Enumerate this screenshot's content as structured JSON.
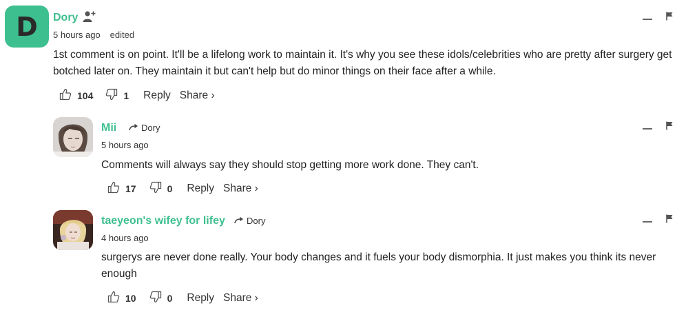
{
  "comments": [
    {
      "avatar_letter": "D",
      "author": "Dory",
      "time": "5 hours ago",
      "edited": "edited",
      "text": "1st comment is on point. It'll be a lifelong work to maintain it. It's why you see these idols/celebrities who are pretty after surgery get botched later on. They maintain it but can't help but do minor things on their face after a while.",
      "likes": "104",
      "dislikes": "1",
      "reply": "Reply",
      "share": "Share ›"
    },
    {
      "author": "Mii",
      "reply_to": "Dory",
      "time": "5 hours ago",
      "text": "Comments will always say they should stop getting more work done. They can't.",
      "likes": "17",
      "dislikes": "0",
      "reply": "Reply",
      "share": "Share ›"
    },
    {
      "author": "taeyeon's wifey for lifey",
      "reply_to": "Dory",
      "time": "4 hours ago",
      "text": "surgerys are never done really. Your body changes and it fuels your body dismorphia. It just makes you think its never enough",
      "likes": "10",
      "dislikes": "0",
      "reply": "Reply",
      "share": "Share ›"
    }
  ],
  "colors": {
    "accent": "#3dbf8f",
    "text": "#222222",
    "muted": "#333333"
  }
}
